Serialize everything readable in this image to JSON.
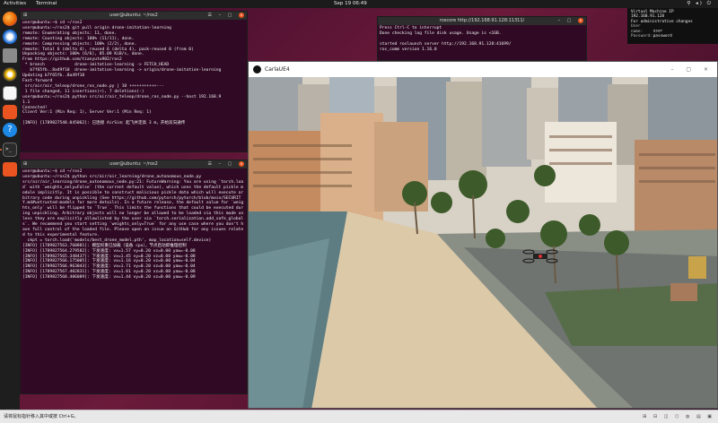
{
  "topbar": {
    "activities": "Activities",
    "app": "Terminal",
    "clock": "Sep 19  06:49",
    "tray": "⚲ ◂) ⏻"
  },
  "dock": {
    "items": [
      "firefox-icon",
      "thunderbird-icon",
      "files-icon",
      "rhythmbox-icon",
      "libreoffice-icon",
      "software-icon",
      "help-icon",
      "amazon-icon",
      "terminal-icon",
      "ubuntu-icon"
    ]
  },
  "term_top": {
    "title": "user@ubuntu: ~/ros2",
    "lines": [
      "user@ubuntu:~$ cd ~/ros2",
      "user@ubuntu:~/ros2$ git pull origin drone-imitation-learning",
      "remote: Enumerating objects: 11, done.",
      "remote: Counting objects: 100% (11/11), done.",
      "remote: Compressing objects: 100% (2/2), done.",
      "remote: Total 6 (delta 4), reused 6 (delta 4), pack-reused 0 (from 0)",
      "Unpacking objects: 100% (6/6), 85.09 KiB/s, done.",
      "From https://github.com/tianyutu902/ros2",
      " * branch            drone-imitation-learning -> FETCH_HEAD",
      "   b7f65fb..8a49f10  drone-imitation-learning -> origin/drone-imitation-learning",
      "Updating b7f65fb..8a49f10",
      "Fast-forward",
      " src/air/air_teleop/drone_ros_node.py | 10 +++++++++++---",
      " 1 file changed, 11 insertions(+), 7 deletions(-)",
      "user@ubuntu:~/ros2$ python src/air/air_teleop/drone_ros_node.py --host 192.168.9",
      "1.1",
      "Connected!",
      "Client Ver:1 (Min Req: 1), Server Ver:1 (Min Req: 1)",
      "",
      "[INFO] [1789827548.045062]: 已连接 AirSim：起飞并定高 3 m，开始双向通传"
    ]
  },
  "term_roscore": {
    "title": "roscore http://192.168.91.128:11311/",
    "lines": [
      "Press Ctrl-C to interrupt",
      "Done checking log file disk usage. Usage is <1GB.",
      "",
      "started roslaunch server http://192.168.91.128:41699/",
      "ros_comm version 1.16.0"
    ]
  },
  "term_bottom": {
    "title": "user@ubuntu: ~/ros2",
    "lines": [
      "user@ubuntu:~$ cd ~/ros2",
      "user@ubuntu:~/ros2$ python src/air/air_learning/drone_autonomous_node.py",
      "src/air/air_learning/drone_autonomous_node.py:21: FutureWarning: You are using `torch.load` with `weights_only=False` (the current default value), which uses the default pickle module implicitly. It is possible to construct malicious pickle data which will execute arbitrary code during unpickling (See https://github.com/pytorch/pytorch/blob/main/SECURITY.md#untrusted-models for more details). In a future release, the default value for `weights_only` will be flipped to `True`. This limits the functions that could be executed during unpickling. Arbitrary objects will no longer be allowed to be loaded via this mode unless they are explicitly allowlisted by the user via `torch.serialization.add_safe_globals`. We recommend you start setting `weights_only=True` for any use case where you don't have full control of the loaded file. Please open an issue on GitHub for any issues related to this experimental feature.",
      "  ckpt = torch.load('models/best_drone_model.pth', map_location=self.device)",
      "[INFO] [1789827563.760881]: 模型权重已加载（设备 cpu），节点启动即推理控制",
      "[INFO] [1789827564.279582]: 下发速度: vx=1.57 vy=0.20 vz=0.00 yaw=-0.08",
      "[INFO] [1789827565.348437]: 下发速度: vx=1.45 vy=0.20 vz=0.00 yaw=-0.08",
      "[INFO] [1789827566.175005]: 下发速度: vx=1.16 vy=0.20 vz=0.00 yaw=-0.04",
      "[INFO] [1789827566.963043]: 下发速度: vx=1.71 vy=0.20 vz=0.00 yaw=-0.04",
      "[INFO] [1789827567.402831]: 下发速度: vx=1.81 vy=0.20 vz=0.00 yaw=-0.08",
      "[INFO] [1789827568.406089]: 下发速度: vx=1.44 vy=0.20 vz=0.00 yaw=-0.09"
    ]
  },
  "carla": {
    "title": "CarlaUE4"
  },
  "vminfo": {
    "title": "Virtual Machine IP",
    "ip": "192.168.91.128",
    "note": "For administrative changes",
    "user_label": "User name:",
    "user_value": "user",
    "pass_label": "Password:",
    "pass_value": "password"
  },
  "taskbar": {
    "hint": "请将鼠标指针移入其中或按 Ctrl+G。",
    "tray": "⊞ ⊟ ◫ ⬡ ◍ ▤ ▣"
  },
  "colors": {
    "desktop": "#6b1a3a",
    "terminal_bg": "#300a24",
    "close_btn": "#e95420",
    "prompt_user": "#8ae234",
    "prompt_path": "#729fcf"
  }
}
